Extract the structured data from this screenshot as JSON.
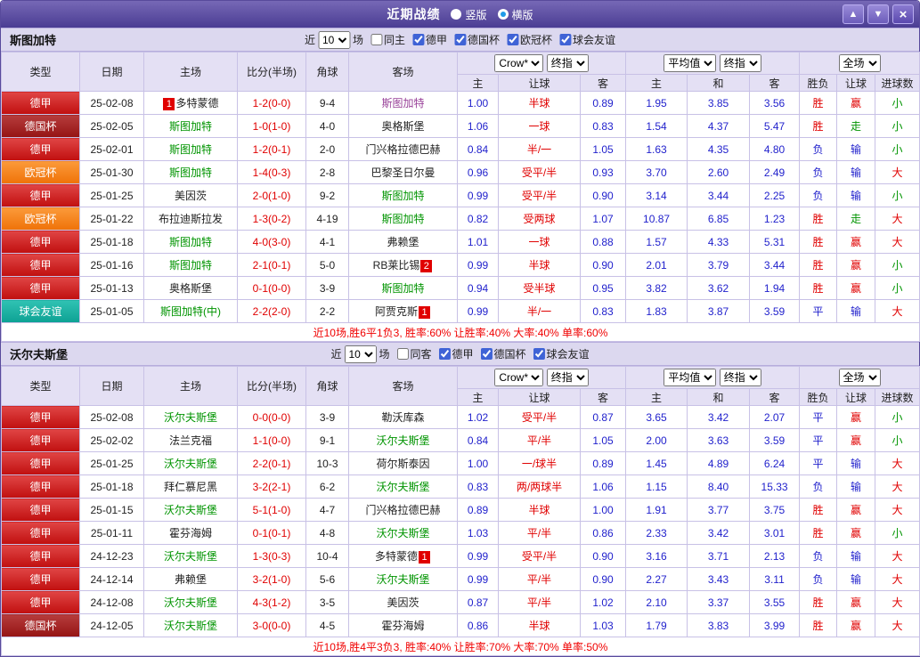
{
  "titlebar": {
    "title": "近期战绩",
    "vertical_label": "竖版",
    "horizontal_label": "横版",
    "up_icon": "▲",
    "down_icon": "▼",
    "close_icon": "×"
  },
  "table_header": {
    "type": "类型",
    "date": "日期",
    "home": "主场",
    "score": "比分(半场)",
    "corner": "角球",
    "away": "客场",
    "crow": "Crow*",
    "final1": "终指",
    "avg": "平均值",
    "final2": "终指",
    "full": "全场",
    "h": "主",
    "handicap": "让球",
    "a": "客",
    "avg_h": "主",
    "draw": "和",
    "avg_a": "客",
    "result": "胜负",
    "handicap_res": "让球",
    "goals": "进球数"
  },
  "colors": {
    "league_deja": "#d01818",
    "league_cup": "#a01818",
    "league_ucl": "#f58220",
    "league_friendly": "#1ab0a2",
    "win_text": "#e00000",
    "loss_text": "#1f1fcc",
    "green_text": "#009400",
    "focus_team": "#009400",
    "titlebar": "#5a4a9c"
  },
  "sections": [
    {
      "team": "斯图加特",
      "filter": {
        "near_label": "近",
        "count": "10",
        "matches_label": "场",
        "same_label": "同主",
        "same_checked": false,
        "leagues": [
          "德甲",
          "德国杯",
          "欧冠杯",
          "球会友谊"
        ]
      },
      "rows": [
        {
          "league": "德甲",
          "date": "25-02-08",
          "home": "多特蒙德",
          "home_badge": "1",
          "home_badge_pos": "before",
          "away": "斯图加特",
          "away_style": "focus-alt",
          "score": "1-2(0-0)",
          "corner": "9-4",
          "crow": [
            "1.00",
            "半球",
            "0.89"
          ],
          "avg": [
            "1.95",
            "3.85",
            "3.56"
          ],
          "result": "胜",
          "handicap_result": "赢",
          "goals": "小"
        },
        {
          "league": "德国杯",
          "date": "25-02-05",
          "home": "斯图加特",
          "home_style": "focus",
          "away": "奥格斯堡",
          "score": "1-0(1-0)",
          "corner": "4-0",
          "crow": [
            "1.06",
            "一球",
            "0.83"
          ],
          "avg": [
            "1.54",
            "4.37",
            "5.47"
          ],
          "result": "胜",
          "handicap_result": "走",
          "goals": "小"
        },
        {
          "league": "德甲",
          "date": "25-02-01",
          "home": "斯图加特",
          "home_style": "focus",
          "away": "门兴格拉德巴赫",
          "score": "1-2(0-1)",
          "corner": "2-0",
          "crow": [
            "0.84",
            "半/一",
            "1.05"
          ],
          "avg": [
            "1.63",
            "4.35",
            "4.80"
          ],
          "result": "负",
          "handicap_result": "输",
          "goals": "小"
        },
        {
          "league": "欧冠杯",
          "date": "25-01-30",
          "home": "斯图加特",
          "home_style": "focus",
          "away": "巴黎圣日尔曼",
          "score": "1-4(0-3)",
          "corner": "2-8",
          "crow": [
            "0.96",
            "受平/半",
            "0.93"
          ],
          "avg": [
            "3.70",
            "2.60",
            "2.49"
          ],
          "result": "负",
          "handicap_result": "输",
          "goals": "大"
        },
        {
          "league": "德甲",
          "date": "25-01-25",
          "home": "美因茨",
          "away": "斯图加特",
          "away_style": "focus",
          "score": "2-0(1-0)",
          "corner": "9-2",
          "crow": [
            "0.99",
            "受平/半",
            "0.90"
          ],
          "avg": [
            "3.14",
            "3.44",
            "2.25"
          ],
          "result": "负",
          "handicap_result": "输",
          "goals": "小"
        },
        {
          "league": "欧冠杯",
          "date": "25-01-22",
          "home": "布拉迪斯拉发",
          "away": "斯图加特",
          "away_style": "focus",
          "score": "1-3(0-2)",
          "corner": "4-19",
          "crow": [
            "0.82",
            "受两球",
            "1.07"
          ],
          "avg": [
            "10.87",
            "6.85",
            "1.23"
          ],
          "result": "胜",
          "handicap_result": "走",
          "goals": "大"
        },
        {
          "league": "德甲",
          "date": "25-01-18",
          "home": "斯图加特",
          "home_style": "focus",
          "away": "弗赖堡",
          "score": "4-0(3-0)",
          "corner": "4-1",
          "crow": [
            "1.01",
            "一球",
            "0.88"
          ],
          "avg": [
            "1.57",
            "4.33",
            "5.31"
          ],
          "result": "胜",
          "handicap_result": "赢",
          "goals": "大"
        },
        {
          "league": "德甲",
          "date": "25-01-16",
          "home": "斯图加特",
          "home_style": "focus",
          "away": "RB莱比锡",
          "away_badge": "2",
          "score": "2-1(0-1)",
          "corner": "5-0",
          "crow": [
            "0.99",
            "半球",
            "0.90"
          ],
          "avg": [
            "2.01",
            "3.79",
            "3.44"
          ],
          "result": "胜",
          "handicap_result": "赢",
          "goals": "小"
        },
        {
          "league": "德甲",
          "date": "25-01-13",
          "home": "奥格斯堡",
          "away": "斯图加特",
          "away_style": "focus",
          "score": "0-1(0-0)",
          "corner": "3-9",
          "crow": [
            "0.94",
            "受半球",
            "0.95"
          ],
          "avg": [
            "3.82",
            "3.62",
            "1.94"
          ],
          "result": "胜",
          "handicap_result": "赢",
          "goals": "小"
        },
        {
          "league": "球会友谊",
          "date": "25-01-05",
          "home": "斯图加特(中)",
          "home_style": "focus",
          "away": "阿贾克斯",
          "away_badge": "1",
          "score": "2-2(2-0)",
          "corner": "2-2",
          "crow": [
            "0.99",
            "半/一",
            "0.83"
          ],
          "avg": [
            "1.83",
            "3.87",
            "3.59"
          ],
          "result": "平",
          "handicap_result": "输",
          "goals": "大"
        }
      ],
      "summary": "近10场,胜6平1负3, 胜率:60% 让胜率:40% 大率:40% 单率:60%"
    },
    {
      "team": "沃尔夫斯堡",
      "filter": {
        "near_label": "近",
        "count": "10",
        "matches_label": "场",
        "same_label": "同客",
        "same_checked": false,
        "leagues": [
          "德甲",
          "德国杯",
          "球会友谊"
        ]
      },
      "rows": [
        {
          "league": "德甲",
          "date": "25-02-08",
          "home": "沃尔夫斯堡",
          "home_style": "focus",
          "away": "勒沃库森",
          "score": "0-0(0-0)",
          "corner": "3-9",
          "crow": [
            "1.02",
            "受平/半",
            "0.87"
          ],
          "avg": [
            "3.65",
            "3.42",
            "2.07"
          ],
          "result": "平",
          "handicap_result": "赢",
          "goals": "小"
        },
        {
          "league": "德甲",
          "date": "25-02-02",
          "home": "法兰克福",
          "away": "沃尔夫斯堡",
          "away_style": "focus",
          "score": "1-1(0-0)",
          "corner": "9-1",
          "crow": [
            "0.84",
            "平/半",
            "1.05"
          ],
          "avg": [
            "2.00",
            "3.63",
            "3.59"
          ],
          "result": "平",
          "handicap_result": "赢",
          "goals": "小"
        },
        {
          "league": "德甲",
          "date": "25-01-25",
          "home": "沃尔夫斯堡",
          "home_style": "focus",
          "away": "荷尔斯泰因",
          "score": "2-2(0-1)",
          "corner": "10-3",
          "crow": [
            "1.00",
            "一/球半",
            "0.89"
          ],
          "avg": [
            "1.45",
            "4.89",
            "6.24"
          ],
          "result": "平",
          "handicap_result": "输",
          "goals": "大"
        },
        {
          "league": "德甲",
          "date": "25-01-18",
          "home": "拜仁慕尼黑",
          "away": "沃尔夫斯堡",
          "away_style": "focus",
          "score": "3-2(2-1)",
          "corner": "6-2",
          "crow": [
            "0.83",
            "两/两球半",
            "1.06"
          ],
          "avg": [
            "1.15",
            "8.40",
            "15.33"
          ],
          "result": "负",
          "handicap_result": "输",
          "goals": "大"
        },
        {
          "league": "德甲",
          "date": "25-01-15",
          "home": "沃尔夫斯堡",
          "home_style": "focus",
          "away": "门兴格拉德巴赫",
          "score": "5-1(1-0)",
          "corner": "4-7",
          "crow": [
            "0.89",
            "半球",
            "1.00"
          ],
          "avg": [
            "1.91",
            "3.77",
            "3.75"
          ],
          "result": "胜",
          "handicap_result": "赢",
          "goals": "大"
        },
        {
          "league": "德甲",
          "date": "25-01-11",
          "home": "霍芬海姆",
          "away": "沃尔夫斯堡",
          "away_style": "focus",
          "score": "0-1(0-1)",
          "corner": "4-8",
          "crow": [
            "1.03",
            "平/半",
            "0.86"
          ],
          "avg": [
            "2.33",
            "3.42",
            "3.01"
          ],
          "result": "胜",
          "handicap_result": "赢",
          "goals": "小"
        },
        {
          "league": "德甲",
          "date": "24-12-23",
          "home": "沃尔夫斯堡",
          "home_style": "focus",
          "away": "多特蒙德",
          "away_badge": "1",
          "score": "1-3(0-3)",
          "corner": "10-4",
          "crow": [
            "0.99",
            "受平/半",
            "0.90"
          ],
          "avg": [
            "3.16",
            "3.71",
            "2.13"
          ],
          "result": "负",
          "handicap_result": "输",
          "goals": "大"
        },
        {
          "league": "德甲",
          "date": "24-12-14",
          "home": "弗赖堡",
          "away": "沃尔夫斯堡",
          "away_style": "focus",
          "score": "3-2(1-0)",
          "corner": "5-6",
          "crow": [
            "0.99",
            "平/半",
            "0.90"
          ],
          "avg": [
            "2.27",
            "3.43",
            "3.11"
          ],
          "result": "负",
          "handicap_result": "输",
          "goals": "大"
        },
        {
          "league": "德甲",
          "date": "24-12-08",
          "home": "沃尔夫斯堡",
          "home_style": "focus",
          "away": "美因茨",
          "score": "4-3(1-2)",
          "corner": "3-5",
          "crow": [
            "0.87",
            "平/半",
            "1.02"
          ],
          "avg": [
            "2.10",
            "3.37",
            "3.55"
          ],
          "result": "胜",
          "handicap_result": "赢",
          "goals": "大"
        },
        {
          "league": "德国杯",
          "date": "24-12-05",
          "home": "沃尔夫斯堡",
          "home_style": "focus",
          "away": "霍芬海姆",
          "score": "3-0(0-0)",
          "corner": "4-5",
          "crow": [
            "0.86",
            "半球",
            "1.03"
          ],
          "avg": [
            "1.79",
            "3.83",
            "3.99"
          ],
          "result": "胜",
          "handicap_result": "赢",
          "goals": "大"
        }
      ],
      "summary": "近10场,胜4平3负3, 胜率:40% 让胜率:70% 大率:70% 单率:50%"
    }
  ]
}
